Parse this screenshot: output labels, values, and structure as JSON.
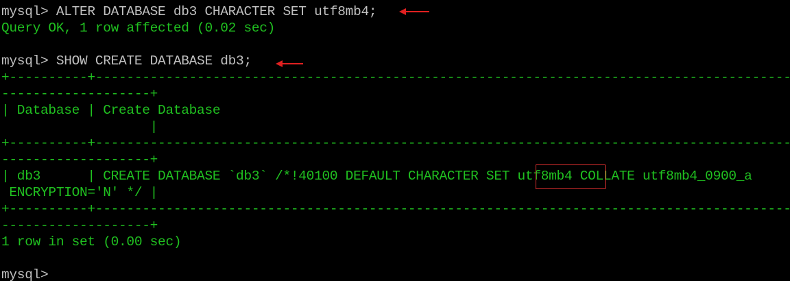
{
  "terminal": {
    "colors": {
      "background": "#000000",
      "text_default": "#c0c0c0",
      "text_result": "#20c020",
      "annotation": "#e02020"
    },
    "lines": {
      "cmd1": "mysql> ALTER DATABASE db3 CHARACTER SET utf8mb4;",
      "res1": "Query OK, 1 row affected (0.02 sec)",
      "cmd2": "mysql> SHOW CREATE DATABASE db3;",
      "border_top_a": "+----------+-----------------------------------------------------------------------------------------------------------------------",
      "border_top_b": "-------------------+",
      "header_a": "| Database | Create Database",
      "header_b": "                   |",
      "border_mid_a": "+----------+-----------------------------------------------------------------------------------------------------------------------",
      "border_mid_b": "-------------------+",
      "row_a": "| db3      | CREATE DATABASE `db3` /*!40100 DEFAULT CHARACTER SET utf8mb4 COLLATE utf8mb4_0900_a",
      "row_b": " ENCRYPTION='N' */ |",
      "border_bot_a": "+----------+-----------------------------------------------------------------------------------------------------------------------",
      "border_bot_b": "-------------------+",
      "res2": "1 row in set (0.00 sec)",
      "prompt": "mysql>"
    },
    "highlight_text": "utf8mb4",
    "annotations": {
      "arrow_1": "red-arrow-icon",
      "arrow_2": "red-arrow-icon"
    }
  }
}
